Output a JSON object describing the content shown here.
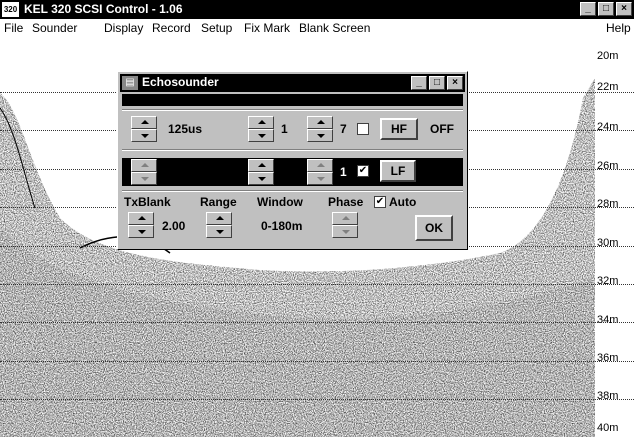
{
  "app": {
    "icon_text": "320",
    "title": "KEL 320 SCSI Control - 1.06",
    "window_buttons": [
      "_",
      "□",
      "×"
    ]
  },
  "menu": {
    "items": [
      "File",
      "Sounder",
      "Display",
      "Record",
      "Setup",
      "Fix Mark",
      "Blank Screen"
    ],
    "right": "Help"
  },
  "depth_scale": [
    "20m",
    "22m",
    "24m",
    "26m",
    "28m",
    "30m",
    "32m",
    "34m",
    "36m",
    "38m",
    "40m"
  ],
  "dialog": {
    "title": "Echosounder",
    "hf_row": {
      "pulse": "125us",
      "gain": "1",
      "tvg": "7",
      "checked": false,
      "button": "HF",
      "status": "OFF"
    },
    "lf_row": {
      "tvg": "1",
      "checked": true,
      "button": "LF"
    },
    "headers": {
      "txblank": "TxBlank",
      "range": "Range",
      "window": "Window",
      "phase": "Phase",
      "auto": "Auto"
    },
    "auto_checked": true,
    "txblank_value": "2.00",
    "window_value": "0-180m",
    "ok": "OK"
  }
}
